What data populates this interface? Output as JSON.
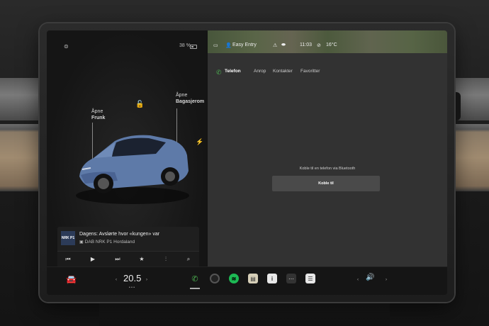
{
  "car_panel": {
    "battery": "38 %",
    "frunk": {
      "line1": "Åpne",
      "line2": "Frunk"
    },
    "trunk": {
      "line1": "Åpne",
      "line2": "Bagasjerom"
    }
  },
  "media": {
    "art_label": "NRK P1",
    "title": "Dagens: Avslørte hvor «kungen» var",
    "station": "DAB NRK P1 Hordaland",
    "controls": [
      "previous-icon",
      "play-icon",
      "next-icon",
      "star-icon",
      "equalizer-icon",
      "search-icon"
    ]
  },
  "status_bar": {
    "profile": "Easy Entry",
    "time": "11:03",
    "temperature": "16°C"
  },
  "phone": {
    "tabs": {
      "phone": "Telefon",
      "calls": "Anrop",
      "contacts": "Kontakter",
      "favorites": "Favoritter"
    },
    "connect_message": "Koble til en telefon via Bluetooth",
    "connect_button": "Koble til"
  },
  "taskbar": {
    "temperature": "20.5",
    "heat_indicator": "• • •",
    "apps": [
      "phone-icon",
      "camera-icon",
      "spotify-icon",
      "notes-icon",
      "manual-icon",
      "more-icon",
      "media-icon"
    ]
  },
  "colors": {
    "accent_green": "#4caf50",
    "spotify_green": "#1db954",
    "car_blue": "#5e7aa8"
  }
}
